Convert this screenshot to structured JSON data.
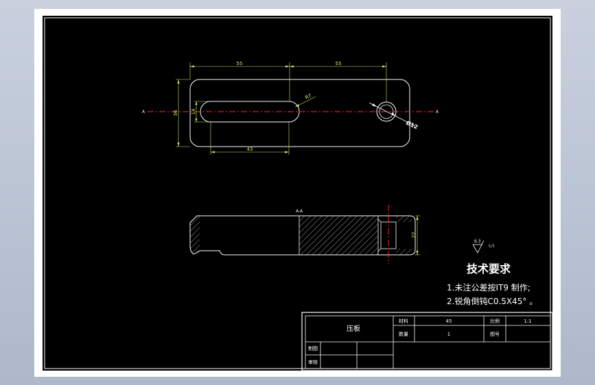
{
  "drawing": {
    "top_view": {
      "section_marker_left": "A",
      "section_marker_right": "A",
      "dim_left_width": "55",
      "dim_right_width": "55",
      "dim_height": "36",
      "dim_slot_width": "14",
      "dim_slot_length": "43",
      "dim_radius": "R7",
      "dim_hole": "Ø12"
    },
    "section_view": {
      "label": "A-A",
      "dim_thickness": "22"
    },
    "roughness": {
      "value": "6.3",
      "note": "(√)"
    },
    "technical_requirements": {
      "heading": "技术要求",
      "line1": "1.未注公差按IT9    制作;",
      "line2": "2.锐角倒钝C0.5X45°      。"
    },
    "title_block": {
      "part_name": "压板",
      "material_label": "材料",
      "material_value": "45",
      "scale_label": "比例",
      "scale_value": "1:1",
      "quantity_label": "数量",
      "quantity_value": "1",
      "drawing_no_label": "图号",
      "drawing_no_value": "",
      "drafter_label": "制图",
      "reviewer_label": "审核"
    }
  },
  "colors": {
    "background": "#000000",
    "outline": "#ffffff",
    "dimension": "#c8f070",
    "centerline": "#ff2a2a"
  }
}
